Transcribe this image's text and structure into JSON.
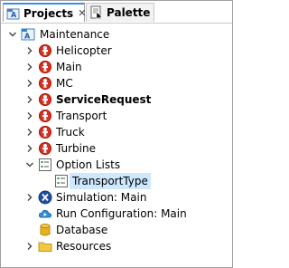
{
  "tabs": [
    {
      "label": "Projects",
      "active": true
    },
    {
      "label": "Palette",
      "active": false
    }
  ],
  "tree": {
    "root": {
      "label": "Maintenance",
      "expanded": true
    },
    "agents": [
      {
        "label": "Helicopter",
        "bold": false
      },
      {
        "label": "Main",
        "bold": false
      },
      {
        "label": "MC",
        "bold": false
      },
      {
        "label": "ServiceRequest",
        "bold": true
      },
      {
        "label": "Transport",
        "bold": false
      },
      {
        "label": "Truck",
        "bold": false
      },
      {
        "label": "Turbine",
        "bold": false
      }
    ],
    "option_lists": {
      "label": "Option Lists",
      "expanded": true,
      "children": [
        {
          "label": "TransportType",
          "selected": true
        }
      ]
    },
    "simulation": {
      "label": "Simulation: Main"
    },
    "run_configuration": {
      "label": "Run Configuration: Main"
    },
    "database": {
      "label": "Database"
    },
    "resources": {
      "label": "Resources"
    }
  },
  "colors": {
    "agent": "#d7301f",
    "selection": "#cde8ff",
    "active_tab_accent": "#3d8ee0"
  }
}
